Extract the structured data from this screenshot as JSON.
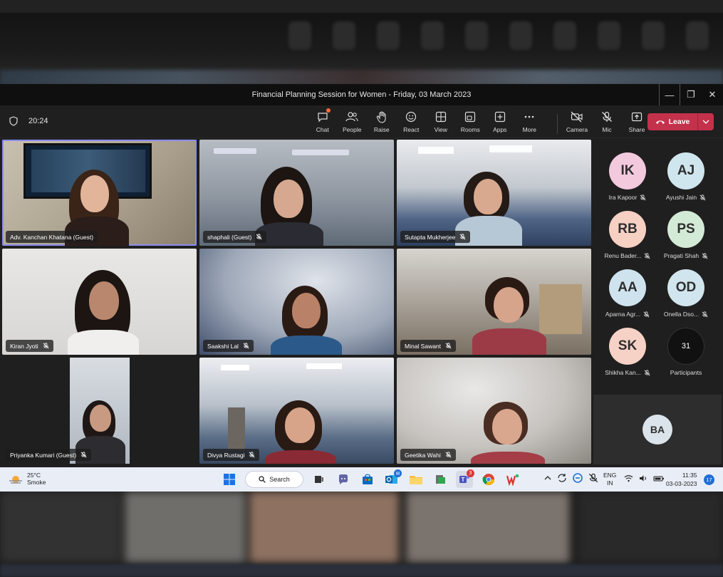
{
  "window": {
    "title": "Financial Planning Session for Women - Friday, 03 March 2023",
    "controls": {
      "minimize": "—",
      "restore": "❐",
      "close": "✕"
    }
  },
  "toolbar": {
    "timer": "20:24",
    "tools": [
      {
        "label": "Chat",
        "icon": "chat-icon"
      },
      {
        "label": "People",
        "icon": "people-icon"
      },
      {
        "label": "Raise",
        "icon": "hand-icon"
      },
      {
        "label": "React",
        "icon": "smile-icon"
      },
      {
        "label": "View",
        "icon": "grid-icon"
      },
      {
        "label": "Rooms",
        "icon": "rooms-icon"
      },
      {
        "label": "Apps",
        "icon": "plus-icon"
      },
      {
        "label": "More",
        "icon": "more-icon"
      }
    ],
    "media": [
      {
        "label": "Camera",
        "icon": "camera-off-icon"
      },
      {
        "label": "Mic",
        "icon": "mic-off-icon"
      },
      {
        "label": "Share",
        "icon": "share-icon"
      }
    ],
    "leave_label": "Leave"
  },
  "tiles": [
    {
      "name": "Adv. Kanchan Khatana (Guest)",
      "muted": false
    },
    {
      "name": "shaphali (Guest)",
      "muted": true
    },
    {
      "name": "Sutapta Mukherjee",
      "muted": true
    },
    {
      "name": "Kiran Jyoti",
      "muted": true
    },
    {
      "name": "Saakshi Lal",
      "muted": true
    },
    {
      "name": "Minal Sawant",
      "muted": true
    },
    {
      "name": "Priyanka Kumari (Guest)",
      "muted": true
    },
    {
      "name": "Divya Rustagi",
      "muted": true
    },
    {
      "name": "Geetika Wahi",
      "muted": true
    }
  ],
  "participants": [
    {
      "initials": "IK",
      "name": "Ira Kapoor",
      "color": "#f3c9de"
    },
    {
      "initials": "AJ",
      "name": "Ayushi Jain",
      "color": "#cfe6ef"
    },
    {
      "initials": "RB",
      "name": "Renu Bader...",
      "color": "#f6d0c3"
    },
    {
      "initials": "PS",
      "name": "Pragati Shah",
      "color": "#d3ead7"
    },
    {
      "initials": "AA",
      "name": "Aparna Agr...",
      "color": "#cfe3ef"
    },
    {
      "initials": "OD",
      "name": "Onella Dso...",
      "color": "#d1e5ee"
    },
    {
      "initials": "SK",
      "name": "Shikha Kan...",
      "color": "#f6d1c6"
    }
  ],
  "participant_count": {
    "count": "31",
    "label": "Participants"
  },
  "extra_tile": {
    "initials": "BA"
  },
  "taskbar": {
    "weather_temp": "25°C",
    "weather_desc": "Smoke",
    "search_label": "Search",
    "teams_badge": "3",
    "lang_1": "ENG",
    "lang_2": "IN",
    "time": "11:35",
    "date": "03-03-2023",
    "notifications": "17"
  }
}
